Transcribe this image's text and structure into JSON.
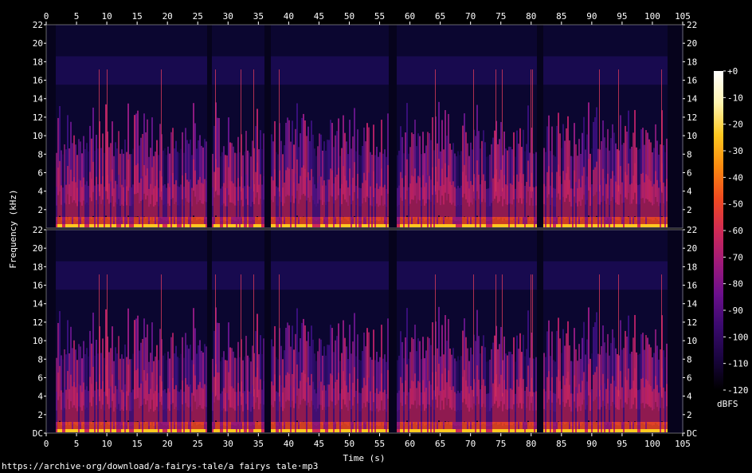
{
  "chart_data": {
    "type": "heatmap",
    "title": "",
    "xlabel": "Time (s)",
    "ylabel": "Frequency (kHz)",
    "xlim": [
      0,
      105
    ],
    "ylim": [
      0,
      22
    ],
    "x_ticks": [
      "0",
      "5",
      "10",
      "15",
      "20",
      "25",
      "30",
      "35",
      "40",
      "45",
      "50",
      "55",
      "60",
      "65",
      "70",
      "75",
      "80",
      "85",
      "90",
      "95",
      "100",
      "105"
    ],
    "y_ticks_top": [
      "22",
      "20",
      "18",
      "16",
      "14",
      "12",
      "10",
      "8",
      "6",
      "4",
      "2"
    ],
    "y_ticks_bottom": [
      "22",
      "20",
      "18",
      "16",
      "14",
      "12",
      "10",
      "8",
      "6",
      "4",
      "2",
      "DC"
    ],
    "channels": 2,
    "colorbar": {
      "label": "dBFS",
      "range": [
        -120,
        0
      ],
      "ticks": [
        "+0",
        "-10",
        "-20",
        "-30",
        "-40",
        "-50",
        "-60",
        "-70",
        "-80",
        "-90",
        "-100",
        "-110",
        "-120"
      ],
      "colors": [
        "#000000",
        "#1a0540",
        "#3a0a6e",
        "#6b0f8c",
        "#a01a7a",
        "#d02a55",
        "#f04a20",
        "#fb8a10",
        "#ffc820",
        "#fff5b0",
        "#ffffff"
      ]
    },
    "silence_gaps_s": [
      [
        0,
        1.5
      ],
      [
        26.3,
        27.2
      ],
      [
        36.0,
        37.0
      ],
      [
        56.3,
        57.7
      ],
      [
        80.8,
        82.0
      ],
      [
        102.3,
        105
      ]
    ]
  },
  "source_url": "https://archive·org/download/a-fairys-tale/a fairys tale·mp3"
}
